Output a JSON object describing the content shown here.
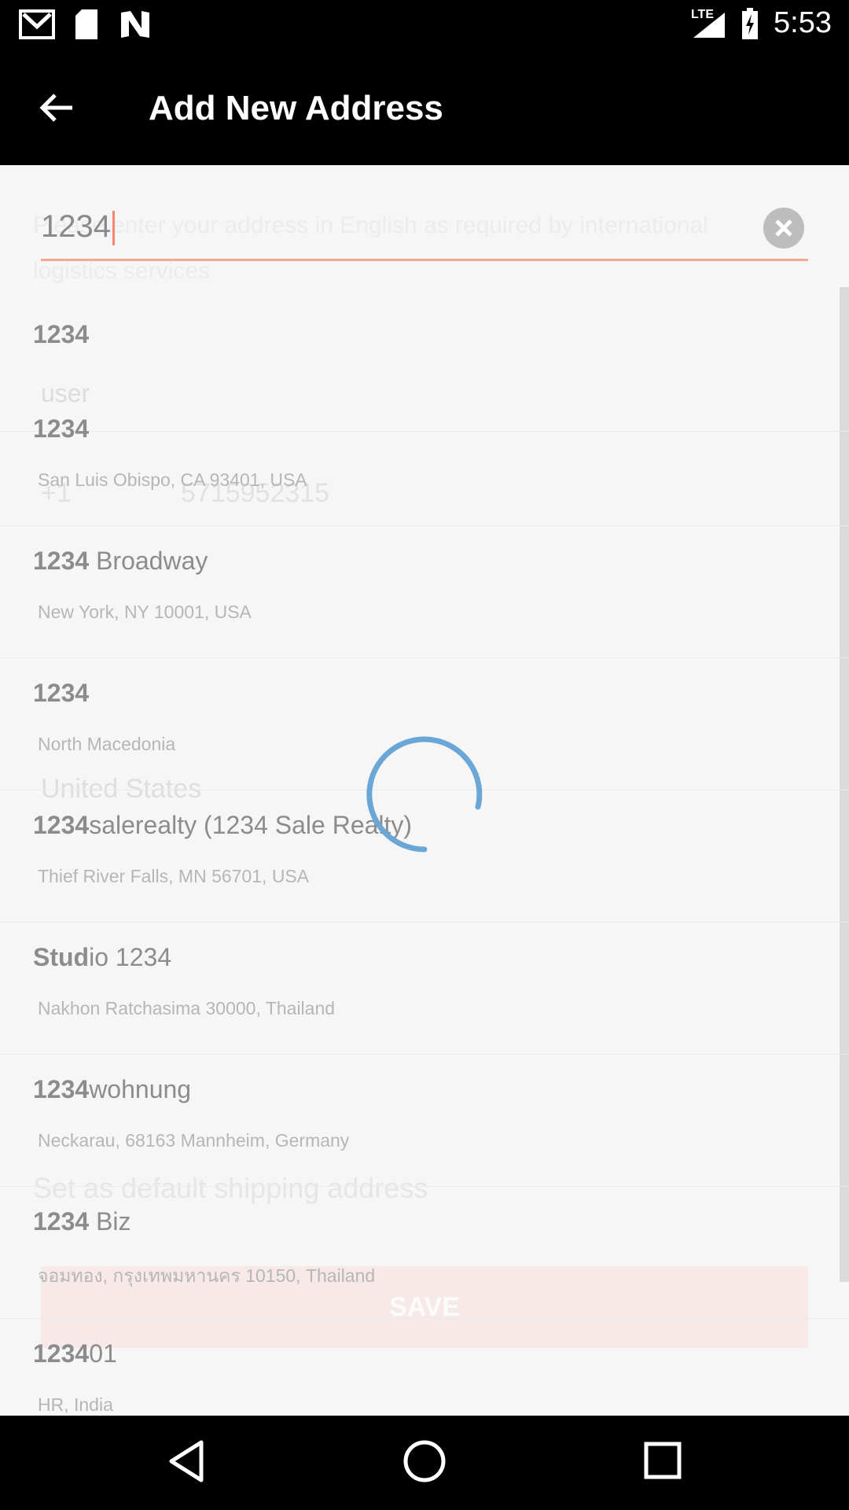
{
  "status_bar": {
    "time": "5:53",
    "network": "LTE"
  },
  "app_bar": {
    "title": "Add New Address"
  },
  "search": {
    "value": "1234"
  },
  "background_form": {
    "notice": "Please enter your address in English as required by international logistics services",
    "name_placeholder": "user",
    "phone_code": "+1",
    "phone_number": "5715952315",
    "country": "United States",
    "default_label": "Set as default shipping address",
    "save_label": "SAVE"
  },
  "suggestions": [
    {
      "bold": "1234",
      "rest": "",
      "sub": ""
    },
    {
      "bold": "1234",
      "rest": "",
      "sub": "San Luis Obispo, CA 93401, USA"
    },
    {
      "bold": "1234",
      "rest": " Broadway",
      "sub": "New York, NY 10001, USA"
    },
    {
      "bold": "1234",
      "rest": "",
      "sub": "North Macedonia"
    },
    {
      "bold": "1234",
      "rest": "salerealty (1234 Sale Realty)",
      "sub": "Thief River Falls, MN 56701, USA"
    },
    {
      "bold": "Stud",
      "rest": "io 1234",
      "sub": "Nakhon Ratchasima 30000, Thailand"
    },
    {
      "bold": "1234",
      "rest": "wohnung",
      "sub": "Neckarau, 68163 Mannheim, Germany"
    },
    {
      "bold": "1234",
      "rest": " Biz",
      "sub": "จอมทอง, กรุงเทพมหานคร 10150, Thailand"
    },
    {
      "bold": "1234",
      "rest": "01",
      "sub": "HR, India"
    }
  ],
  "colors": {
    "accent": "#f5a98c",
    "spinner": "#6aa6d6"
  },
  "icons": {
    "back": "arrow-left-icon",
    "clear": "clear-circle-icon",
    "spinner": "loading-spinner-icon"
  }
}
